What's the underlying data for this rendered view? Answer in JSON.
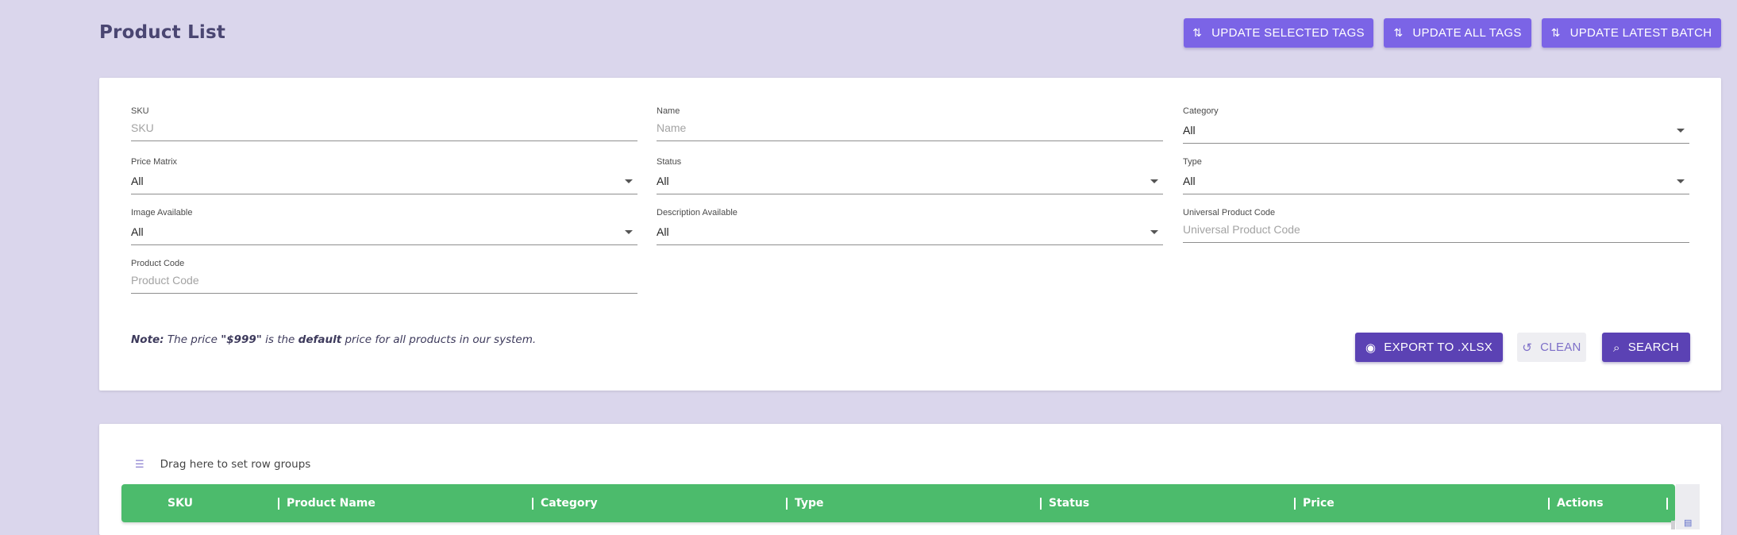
{
  "header": {
    "title": "Product List",
    "buttons": [
      {
        "label": "UPDATE SELECTED TAGS",
        "icon": "swap-vertical-icon"
      },
      {
        "label": "UPDATE ALL TAGS",
        "icon": "swap-vertical-icon"
      },
      {
        "label": "UPDATE LATEST BATCH",
        "icon": "swap-vertical-icon"
      }
    ]
  },
  "filters": {
    "sku": {
      "label": "SKU",
      "placeholder": "SKU"
    },
    "name": {
      "label": "Name",
      "placeholder": "Name"
    },
    "category": {
      "label": "Category",
      "value": "All"
    },
    "price_matrix": {
      "label": "Price Matrix",
      "value": "All"
    },
    "status": {
      "label": "Status",
      "value": "All"
    },
    "type": {
      "label": "Type",
      "value": "All"
    },
    "image_available": {
      "label": "Image Available",
      "value": "All"
    },
    "description_available": {
      "label": "Description Available",
      "value": "All"
    },
    "upc": {
      "label": "Universal Product Code",
      "placeholder": "Universal Product Code"
    },
    "product_code": {
      "label": "Product Code",
      "placeholder": "Product Code"
    }
  },
  "note": {
    "prefix": "Note:",
    "text1": " The price ",
    "price": "\"$999\"",
    "text2": " is the ",
    "emph": "default",
    "text3": " price for all products in our system."
  },
  "actions": {
    "export_label": "EXPORT TO .XLSX",
    "clean_label": "CLEAN",
    "search_label": "SEARCH"
  },
  "grid": {
    "group_hint": "Drag here to set row groups",
    "columns": [
      "SKU",
      "Product Name",
      "Category",
      "Type",
      "Status",
      "Price",
      "Actions"
    ]
  },
  "colors": {
    "background": "#dad6ec",
    "accent": "#7b64e6",
    "primary_button": "#5b42b4",
    "grid_header": "#4cbb6c"
  }
}
